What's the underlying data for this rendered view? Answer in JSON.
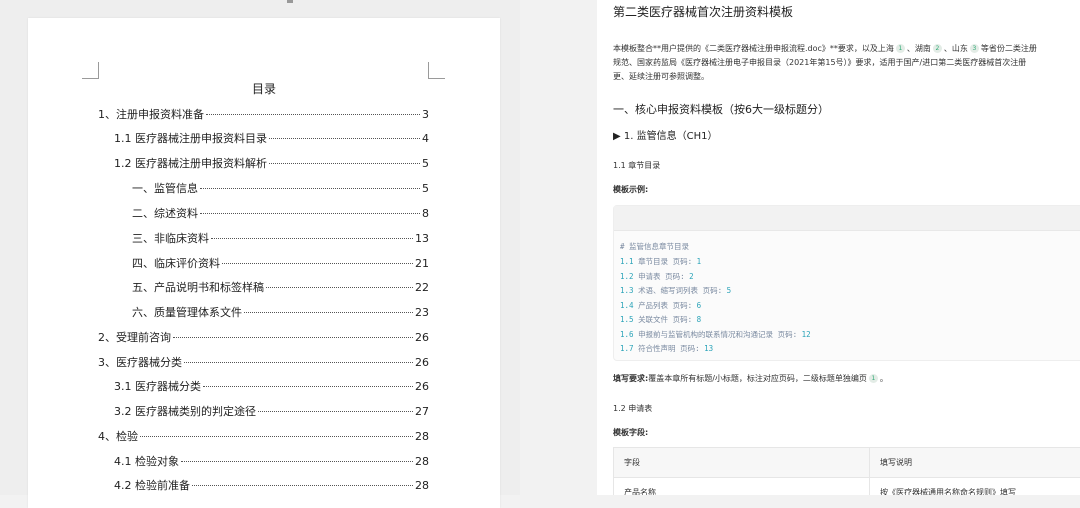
{
  "toc": {
    "title": "目录",
    "entries": [
      {
        "label": "1、注册申报资料准备",
        "page": "3"
      },
      {
        "label": "1.1 医疗器械注册申报资料目录",
        "page": "4"
      },
      {
        "label": "1.2 医疗器械注册申报资料解析",
        "page": "5"
      },
      {
        "label": "一、监管信息",
        "page": "5"
      },
      {
        "label": "二、综述资料",
        "page": "8"
      },
      {
        "label": "三、非临床资料",
        "page": "13"
      },
      {
        "label": "四、临床评价资料",
        "page": "21"
      },
      {
        "label": "五、产品说明书和标签样稿",
        "page": "22"
      },
      {
        "label": "六、质量管理体系文件",
        "page": "23"
      },
      {
        "label": "2、受理前咨询",
        "page": "26"
      },
      {
        "label": "3、医疗器械分类",
        "page": "26"
      },
      {
        "label": "3.1 医疗器械分类",
        "page": "26"
      },
      {
        "label": "3.2 医疗器械类别的判定途径",
        "page": "27"
      },
      {
        "label": "4、检验",
        "page": "28"
      },
      {
        "label": "4.1 检验对象",
        "page": "28"
      },
      {
        "label": "4.2 检验前准备",
        "page": "28"
      }
    ]
  },
  "right": {
    "title": "第二类医疗器械首次注册资料模板",
    "intro_a": "本模板整合**用户提供的《二类医疗器械注册申报流程.doc》**要求，以及上海",
    "cite1": "1",
    "intro_b": "、湖南",
    "cite2": "2",
    "intro_c": "、山东",
    "cite3": "3",
    "intro_d": "等省份二类注册",
    "intro_line2": "规范、国家药监局《医疗器械注册电子申报目录（2021年第15号）》要求，适用于国产/进口第二类医疗器械首次注册",
    "intro_line3": "更、延续注册可参照调整。",
    "section_heading": "一、核心申报资料模板（按6大一级标题分）",
    "ch1_heading": "▶ 1. 监管信息（CH1）",
    "sub_1_1": "1.1 章节目录",
    "example_label": "模板示例:",
    "code_comment": "# 监管信息章节目录",
    "code_lines": [
      {
        "num": "1.1",
        "text": "章节目录 页码:",
        "page": "1"
      },
      {
        "num": "1.2",
        "text": "申请表 页码:",
        "page": "2"
      },
      {
        "num": "1.3",
        "text": "术语、缩写词列表 页码:",
        "page": "5"
      },
      {
        "num": "1.4",
        "text": "产品列表 页码:",
        "page": "6"
      },
      {
        "num": "1.5",
        "text": "关联文件 页码:",
        "page": "8"
      },
      {
        "num": "1.6",
        "text": "申报前与监管机构的联系情况和沟通记录 页码:",
        "page": "12"
      },
      {
        "num": "1.7",
        "text": "符合性声明 页码:",
        "page": "13"
      }
    ],
    "req_label": "填写要求:",
    "req_text": "覆盖本章所有标题/小标题，标注对应页码，二级标题单独编页",
    "req_cite": "1",
    "req_end": "。",
    "sub_1_2": "1.2 申请表",
    "fields_label": "模板字段:",
    "table_headers": [
      "字段",
      "填写说明"
    ],
    "table_rows": [
      [
        "产品名称",
        "按《医疗器械通用名称命名规则》填写"
      ]
    ]
  }
}
